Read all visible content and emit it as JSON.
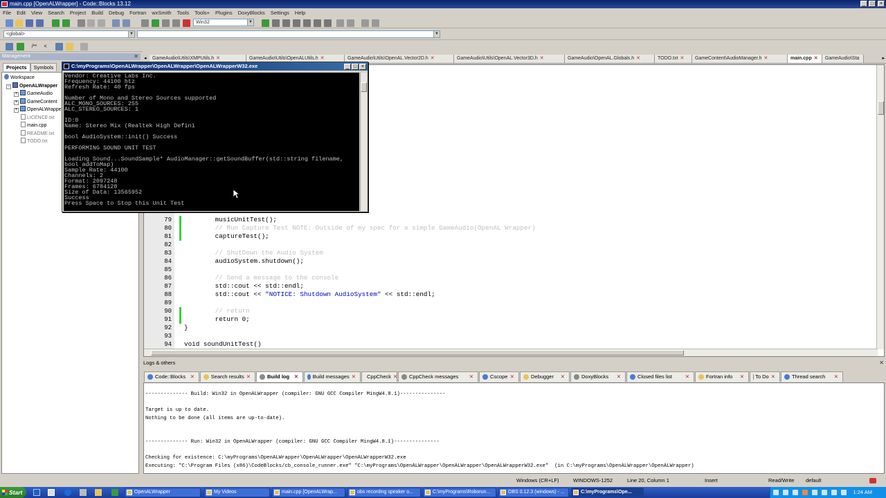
{
  "window": {
    "title": "main.cpp [OpenALWrapper] - Code::Blocks 13.12"
  },
  "menu": [
    "File",
    "Edit",
    "View",
    "Search",
    "Project",
    "Build",
    "Debug",
    "Fortran",
    "wxSmith",
    "Tools",
    "Tools+",
    "Plugins",
    "DoxyBlocks",
    "Settings",
    "Help"
  ],
  "toolbar": {
    "build_target": "Win32",
    "scope": "<global>",
    "function": ""
  },
  "management": {
    "title": "Management",
    "tabs": [
      "Projects",
      "Symbols"
    ],
    "tree": {
      "workspace": "Workspace",
      "project": "OpenALWrapper",
      "folders": [
        "GameAudio",
        "GameContent",
        "OpenALWrapper"
      ],
      "files": [
        "LICENCE.txt",
        "main.cpp",
        "README.txt",
        "TODO.txt"
      ]
    }
  },
  "editor_tabs": [
    "GameAudio\\Utils\\XMPUtils.h",
    "GameAudio\\Utils\\OpenALUtils.h",
    "GameAudio\\Utils\\OpenAL.Vector2D.h",
    "GameAudio\\Utils\\OpenAL.Vector3D.h",
    "GameAudio\\OpenAL.Globals.h",
    "TODO.txt",
    "GameContent\\AudioManager.h",
    "main.cpp",
    "GameAudio\\Sta"
  ],
  "editor_active_tab": "main.cpp",
  "code_lines": [
    {
      "n": "79",
      "parts": [
        {
          "t": "        musicUnitTest();",
          "c": ""
        }
      ]
    },
    {
      "n": "80",
      "parts": [
        {
          "t": "        // Run Capture Test NOTE: Outside of my spec for a simple GameAudio(OpenAL Wrapper)",
          "c": "cm"
        }
      ]
    },
    {
      "n": "81",
      "parts": [
        {
          "t": "        captureTest();",
          "c": ""
        }
      ]
    },
    {
      "n": "82",
      "parts": [
        {
          "t": "",
          "c": ""
        }
      ]
    },
    {
      "n": "83",
      "parts": [
        {
          "t": "        // ShutDown the Audio System",
          "c": "cm"
        }
      ]
    },
    {
      "n": "84",
      "parts": [
        {
          "t": "        audioSystem.shutdown();",
          "c": ""
        }
      ]
    },
    {
      "n": "85",
      "parts": [
        {
          "t": "",
          "c": ""
        }
      ]
    },
    {
      "n": "86",
      "parts": [
        {
          "t": "        // Send a message to the console",
          "c": "cm"
        }
      ]
    },
    {
      "n": "87",
      "parts": [
        {
          "t": "        std::cout << std::endl;",
          "c": ""
        }
      ]
    },
    {
      "n": "88",
      "parts": [
        {
          "t": "        std::cout << ",
          "c": ""
        },
        {
          "t": "\"NOTICE: Shutdown AudioSystem\"",
          "c": "str"
        },
        {
          "t": " << std::endl;",
          "c": ""
        }
      ]
    },
    {
      "n": "89",
      "parts": [
        {
          "t": "",
          "c": ""
        }
      ]
    },
    {
      "n": "90",
      "parts": [
        {
          "t": "        // return",
          "c": "cm"
        }
      ]
    },
    {
      "n": "91",
      "parts": [
        {
          "t": "        return 0;",
          "c": ""
        }
      ]
    },
    {
      "n": "92",
      "parts": [
        {
          "t": "}",
          "c": ""
        }
      ]
    },
    {
      "n": "93",
      "parts": [
        {
          "t": "",
          "c": ""
        }
      ]
    },
    {
      "n": "94",
      "parts": [
        {
          "t": "void soundUnitTest()",
          "c": ""
        }
      ]
    }
  ],
  "console": {
    "title": "C:\\myPrograms\\OpenALWrapper\\OpenALWrapper\\OpenALWrapperW32.exe",
    "text": "Vendor: Creative Labs Inc.\nFrequency: 44100 htz\nRefresh Rate: 40 fps\n\nNumber of Mono and Stereo Sources supported\nALC_MONO_SOURCES: 255\nALC_STEREO_SOURCES: 1\n\nID:0\nName: Stereo Mix (Realtek High Defini\n\nbool AudioSystem::init() Success\n\nPERFORMING SOUND UNIT TEST\n\nLoading Sound...SoundSample* AudioManager::getSoundBuffer(std::string filename,\nbool addToMap)\nSample Rate: 44100\nChannels: 2\nFormat: 2097248\nFrames: 6784128\nSize of Data: 13565952\nSuccess\nPress Space to Stop this Unit Test"
  },
  "logs": {
    "title": "Logs & others",
    "tabs": [
      "Code::Blocks",
      "Search results",
      "Build log",
      "Build messages",
      "CppCheck",
      "CppCheck messages",
      "Cscope",
      "Debugger",
      "DoxyBlocks",
      "Closed files list",
      "Fortran info",
      "To Do",
      "Thread search"
    ],
    "active": "Build log",
    "text": "-------------- Build: Win32 in OpenALWrapper (compiler: GNU GCC Compiler MingW4.8.1)---------------\n\nTarget is up to date.\nNothing to be done (all items are up-to-date).\n\n\n-------------- Run: Win32 in OpenALWrapper (compiler: GNU GCC Compiler MingW4.8.1)---------------\n\nChecking for existence: C:\\myPrograms\\OpenALWrapper\\OpenALWrapper\\OpenALWrapperW32.exe\nExecuting: \"C:\\Program Files (x86)\\CodeBlocks/cb_console_runner.exe\" \"C:\\myPrograms\\OpenALWrapper\\OpenALWrapper\\OpenALWrapperW32.exe\"  (in C:\\myPrograms\\OpenALWrapper\\OpenALWrapper)"
  },
  "status": {
    "eol": "Windows (CR+LF)",
    "encoding": "WINDOWS-1252",
    "position": "Line 20, Column 1",
    "mode": "Insert",
    "access": "Read/Write",
    "profile": "default"
  },
  "taskbar": {
    "start": "Start",
    "tasks": [
      "OpenALWrapper",
      "My Videos",
      "main.cpp [OpenALWrap...",
      "obs recording speaker o...",
      "C:\\myPrograms\\Roborun...",
      "OBS 0.12.3 (windows) - ...",
      "C:\\myPrograms\\Ope..."
    ],
    "clock": "1:24 AM"
  }
}
